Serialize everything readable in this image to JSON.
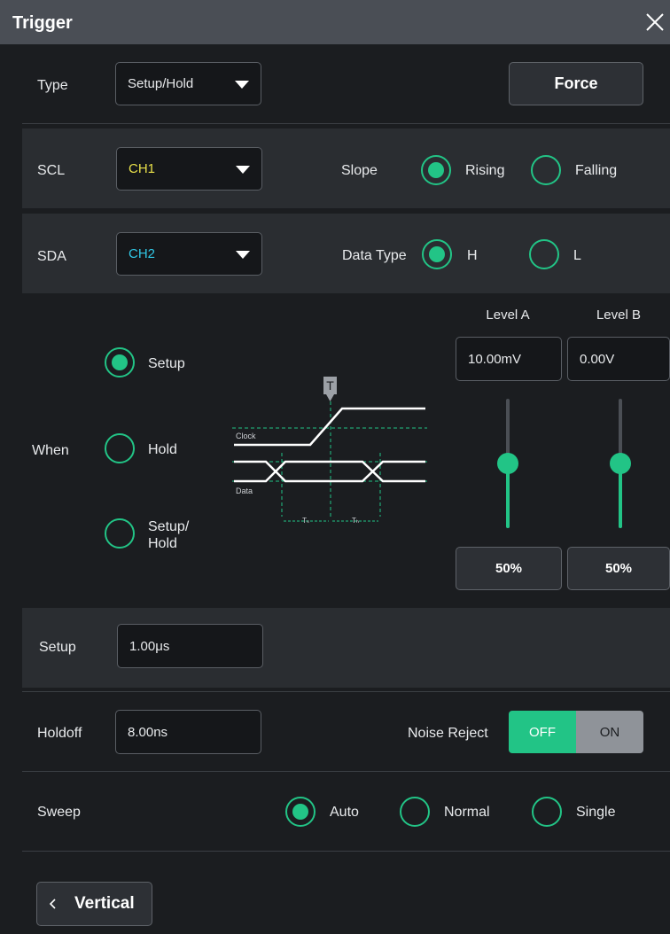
{
  "window": {
    "title": "Trigger"
  },
  "type_row": {
    "label": "Type",
    "value": "Setup/Hold",
    "force": "Force"
  },
  "scl_row": {
    "label": "SCL",
    "source": "CH1",
    "source_color": "#e8e04a",
    "slope_label": "Slope",
    "slope_options": [
      {
        "label": "Rising",
        "selected": true
      },
      {
        "label": "Falling",
        "selected": false
      }
    ]
  },
  "sda_row": {
    "label": "SDA",
    "source": "CH2",
    "source_color": "#31c8e6",
    "datatype_label": "Data Type",
    "datatype_options": [
      {
        "label": "H",
        "selected": true
      },
      {
        "label": "L",
        "selected": false
      }
    ]
  },
  "when": {
    "label": "When",
    "options": [
      {
        "label": "Setup",
        "selected": true
      },
      {
        "label": "Hold",
        "selected": false
      },
      {
        "label": "Setup/\nHold",
        "selected": false
      }
    ],
    "diagram": {
      "trigger_marker": "T",
      "clock_label": "Clock",
      "data_label": "Data",
      "setup_time_label": "Tₛ",
      "hold_time_label": "Tₕ"
    }
  },
  "levels": {
    "a": {
      "label": "Level A",
      "value": "10.00mV",
      "percent_label": "50%",
      "percent": 50
    },
    "b": {
      "label": "Level B",
      "value": "0.00V",
      "percent_label": "50%",
      "percent": 50
    }
  },
  "setup_row": {
    "label": "Setup",
    "value": "1.00μs"
  },
  "holdoff_row": {
    "label": "Holdoff",
    "value": "8.00ns",
    "noise_reject_label": "Noise Reject",
    "noise_off": "OFF",
    "noise_on": "ON",
    "noise_state": "OFF"
  },
  "sweep_row": {
    "label": "Sweep",
    "options": [
      {
        "label": "Auto",
        "selected": true
      },
      {
        "label": "Normal",
        "selected": false
      },
      {
        "label": "Single",
        "selected": false
      }
    ]
  },
  "nav": {
    "back_label": "Vertical",
    "back_icon": "chevron-left-icon"
  },
  "colors": {
    "accent": "#22c486",
    "background": "#1b1d20",
    "panel": "#2a2d31"
  }
}
